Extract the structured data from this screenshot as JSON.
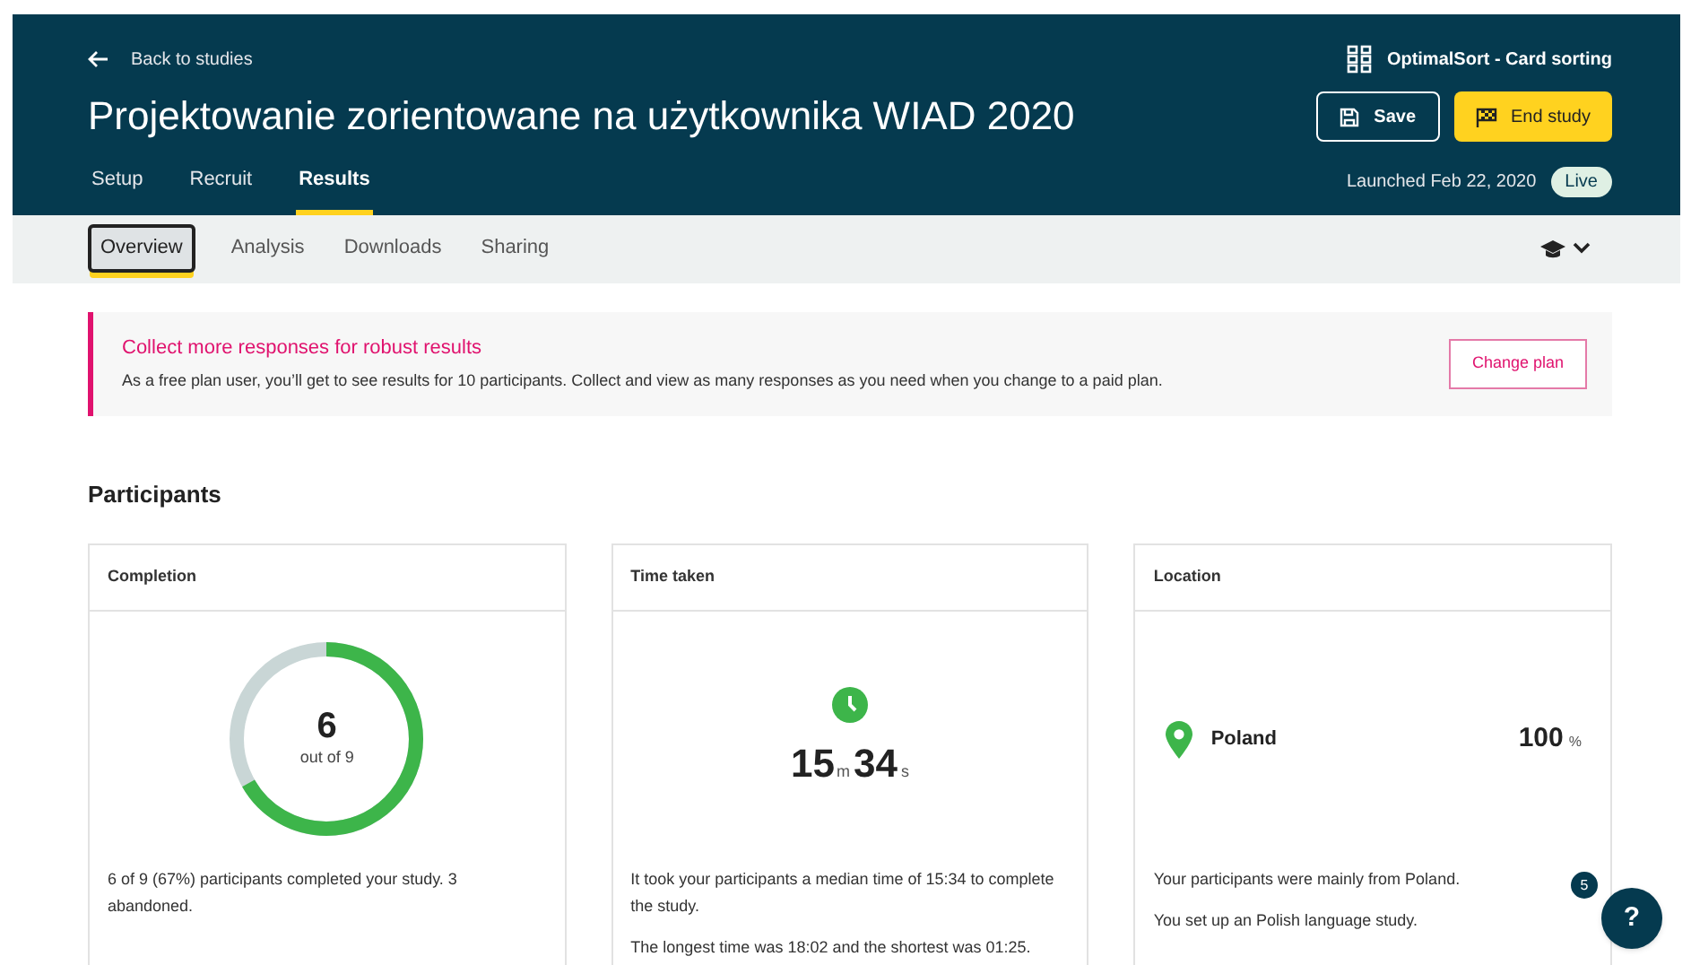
{
  "header": {
    "back_link": "Back to studies",
    "product": "OptimalSort - Card sorting",
    "title": "Projektowanie zorientowane na użytkownika WIAD 2020",
    "buttons": [
      {
        "label": "Save",
        "kind": "save"
      },
      {
        "label": "End study",
        "kind": "end"
      }
    ],
    "tabs": [
      {
        "label": "Setup",
        "selected": false
      },
      {
        "label": "Recruit",
        "selected": false
      },
      {
        "label": "Results",
        "selected": true
      }
    ],
    "launched": "Launched Feb 22, 2020",
    "status": "Live"
  },
  "subtabs": [
    {
      "label": "Overview",
      "selected": true
    },
    {
      "label": "Analysis",
      "selected": false
    },
    {
      "label": "Downloads",
      "selected": false
    },
    {
      "label": "Sharing",
      "selected": false
    }
  ],
  "banner": {
    "title": "Collect more responses for robust results",
    "text": "As a free plan user, you’ll get to see results for 10 participants. Collect and view as many responses as you need when you change to a paid plan.",
    "button": "Change plan"
  },
  "section_title": "Participants",
  "cards": [
    {
      "kind": "completion",
      "title": "Completion",
      "value": "6",
      "caption": "out of 9",
      "paragraphs": [
        "6 of 9 (67%) participants completed your study. 3 abandoned."
      ]
    },
    {
      "kind": "time",
      "title": "Time taken",
      "minutes": "15",
      "minutes_unit": "m",
      "seconds": "34",
      "seconds_unit": "s",
      "paragraphs": [
        "It took your participants a median time of 15:34 to complete the study.",
        "The longest time was 18:02 and the shortest was 01:25."
      ]
    },
    {
      "kind": "location",
      "title": "Location",
      "country": "Poland",
      "percent": "100",
      "percent_unit": "%",
      "paragraphs": [
        "Your participants were mainly from Poland.",
        "You set up an Polish language study."
      ]
    }
  ],
  "help": {
    "label": "?",
    "badge": "5"
  }
}
